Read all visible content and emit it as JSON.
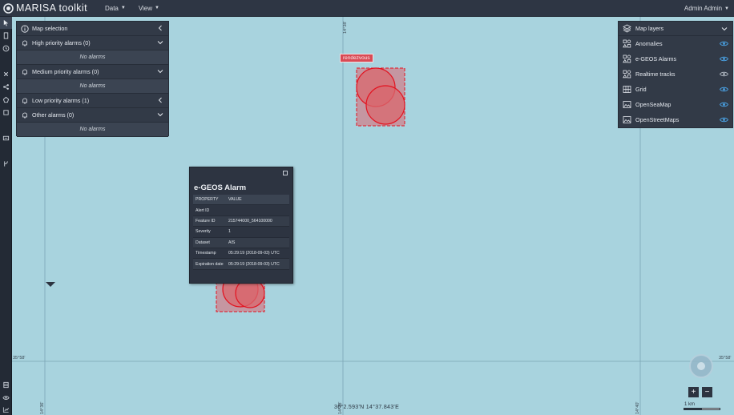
{
  "app": {
    "title": "MARISA toolkit"
  },
  "topbar": {
    "menus": [
      {
        "label": "Data"
      },
      {
        "label": "View"
      }
    ],
    "user": "Admin Admin"
  },
  "map_selection": {
    "title": "Map selection",
    "groups": [
      {
        "label": "High priority alarms (0)",
        "expanded": true,
        "empty_text": "No alarms"
      },
      {
        "label": "Medium priority alarms (0)",
        "expanded": true,
        "empty_text": "No alarms"
      },
      {
        "label": "Low priority alarms (1)",
        "expanded": false
      },
      {
        "label": "Other alarms (0)",
        "expanded": true,
        "empty_text": "No alarms"
      }
    ]
  },
  "map_layers": {
    "title": "Map layers",
    "items": [
      {
        "label": "Anomalies",
        "icon": "shapes-icon",
        "visible": true
      },
      {
        "label": "e-GEOS Alarms",
        "icon": "shapes-icon",
        "visible": true
      },
      {
        "label": "Realtime tracks",
        "icon": "shapes-icon",
        "visible": false
      },
      {
        "label": "Grid",
        "icon": "grid-icon",
        "visible": true
      },
      {
        "label": "OpenSeaMap",
        "icon": "image-icon",
        "visible": true
      },
      {
        "label": "OpenStreetMaps",
        "icon": "image-icon",
        "visible": true
      }
    ]
  },
  "alarm_popup": {
    "title": "e-GEOS Alarm",
    "columns": [
      "PROPERTY",
      "VALUE"
    ],
    "rows": [
      {
        "property": "Alert ID",
        "value": ""
      },
      {
        "property": "Feature ID",
        "value": "215744000_564100000"
      },
      {
        "property": "Severity",
        "value": "1"
      },
      {
        "property": "Dataset",
        "value": "AIS"
      },
      {
        "property": "Timestamp",
        "value": "05:29:19 (2018-09-03) UTC"
      },
      {
        "property": "Expiration date",
        "value": "05:29:19 (2018-09-03) UTC"
      }
    ]
  },
  "map": {
    "rendezvous_label": "rendezvous",
    "grid_labels": {
      "lat_left": "35°58'",
      "lat_right": "35°58'",
      "lon_top": "14°38'",
      "lon_bottom_left": "14°36'",
      "lon_bottom_mid": "14°38'",
      "lon_bottom_right": "14°40'"
    },
    "coordinates": "36°2.593'N 14°37.843'E",
    "scale_label": "1 km"
  },
  "zoom": {
    "in_label": "+",
    "out_label": "−"
  },
  "colors": {
    "alarm_fill": "#dc6470",
    "alarm_stroke": "#e3121f",
    "sea": "#a8d3de",
    "panel": "#323a47",
    "eye_on": "#4aa3e6"
  }
}
